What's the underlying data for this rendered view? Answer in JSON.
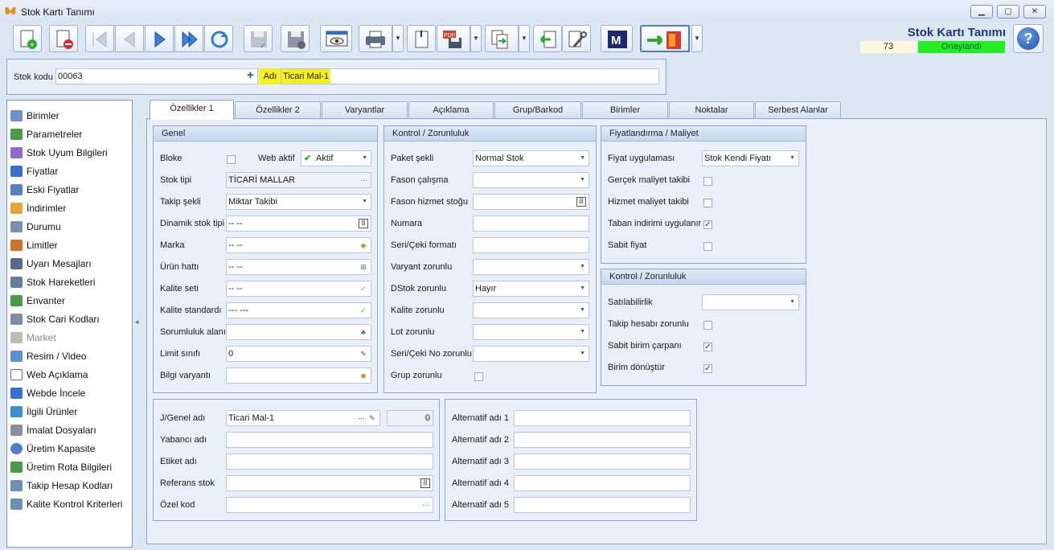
{
  "window": {
    "title": "Stok Kartı Tanımı"
  },
  "header": {
    "title": "Stok Kartı Tanımı",
    "record_no": "73",
    "status": "Onaylandı"
  },
  "stok": {
    "kodu_label": "Stok kodu",
    "kodu_value": "00063",
    "adi_label": "Adı",
    "adi_value": "Ticari  Mal-1"
  },
  "sidebar": {
    "items": [
      {
        "label": "Birimler"
      },
      {
        "label": "Parametreler"
      },
      {
        "label": "Stok Uyum Bilgileri"
      },
      {
        "label": "Fiyatlar"
      },
      {
        "label": "Eski Fiyatlar"
      },
      {
        "label": "İndirimler"
      },
      {
        "label": "Durumu"
      },
      {
        "label": "Limitler"
      },
      {
        "label": "Uyarı Mesajları"
      },
      {
        "label": "Stok Hareketleri"
      },
      {
        "label": "Envanter"
      },
      {
        "label": "Stok Cari Kodları"
      },
      {
        "label": "Market"
      },
      {
        "label": "Resim / Video"
      },
      {
        "label": "Web Açıklama"
      },
      {
        "label": "Webde İncele"
      },
      {
        "label": "İlgili Ürünler"
      },
      {
        "label": "İmalat Dosyaları"
      },
      {
        "label": "Üretim Kapasite"
      },
      {
        "label": "Üretim Rota Bilgileri"
      },
      {
        "label": "Takip Hesap Kodları"
      },
      {
        "label": "Kalite Kontrol Kriterleri"
      }
    ]
  },
  "tabs": [
    "Özellikler 1",
    "Özellikler 2",
    "Varyantlar",
    "Açıklama",
    "Grup/Barkod",
    "Birimler",
    "Noktalar",
    "Serbest Alanlar"
  ],
  "genel": {
    "title": "Genel",
    "bloke": "Bloke",
    "web_aktif": "Web aktif",
    "web_aktif_value": "Aktif",
    "stok_tipi": "Stok tipi",
    "stok_tipi_value": "TİCARİ MALLAR",
    "takip_sekli": "Takip şekli",
    "takip_sekli_value": "Miktar Takibi",
    "dinamik": "Dinamik stok tipi",
    "dinamik_value": "-- --",
    "marka": "Marka",
    "marka_value": "-- --",
    "urun_hatti": "Ürün hattı",
    "urun_hatti_value": "-- --",
    "kalite_seti": "Kalite seti",
    "kalite_seti_value": "-- --",
    "kalite_std": "Kalite standardı",
    "kalite_std_value": "--- ---",
    "sorumluluk": "Sorumluluk alanı",
    "sorumluluk_value": "",
    "limit": "Limit sınıfı",
    "limit_value": "0",
    "bilgi": "Bilgi varyantı",
    "bilgi_value": ""
  },
  "kontrol": {
    "title": "Kontrol / Zorunluluk",
    "paket": "Paket şekli",
    "paket_value": "Normal Stok",
    "fason": "Fason çalışma",
    "fason_hizmet": "Fason hizmet stoğu",
    "numara": "Numara",
    "seri_format": "Seri/Çeki formatı",
    "varyant": "Varyant zorunlu",
    "dstok": "DStok zorunlu",
    "dstok_value": "Hayır",
    "kalite": "Kalite zorunlu",
    "lot": "Lot zorunlu",
    "seri_no": "Seri/Çeki No zorunlu",
    "grup": "Grup zorunlu"
  },
  "fiyat": {
    "title": "Fiyatlandırma / Maliyet",
    "uygulama": "Fiyat uygulaması",
    "uygulama_value": "Stok Kendi Fiyatı",
    "gercek": "Gerçek maliyet takibi",
    "hizmet": "Hizmet maliyet takibi",
    "taban": "Taban indirimi uygulanır",
    "sabit": "Sabit fiyat"
  },
  "kontrol2": {
    "title": "Kontrol / Zorunluluk",
    "satilabilirlik": "Satılabilirlik",
    "takip": "Takip hesabı zorunlu",
    "sabit_birim": "Sabit birim çarpanı",
    "birim_donustur": "Birim dönüştür"
  },
  "adlar": {
    "genel": "J/Genel adı",
    "genel_value": "Ticari  Mal-1",
    "genel_count": "0",
    "yabanci": "Yabancı adı",
    "etiket": "Etiket adı",
    "referans": "Referans stok",
    "ozel": "Özel kod"
  },
  "alternatif": {
    "labels": [
      "Alternatif adı 1",
      "Alternatif adı 2",
      "Alternatif adı 3",
      "Alternatif adı 4",
      "Alternatif adı 5"
    ]
  },
  "colors": {
    "status_green": "#22ee22",
    "highlight_yellow": "#f4f11d",
    "title_blue": "#1c3a78"
  }
}
